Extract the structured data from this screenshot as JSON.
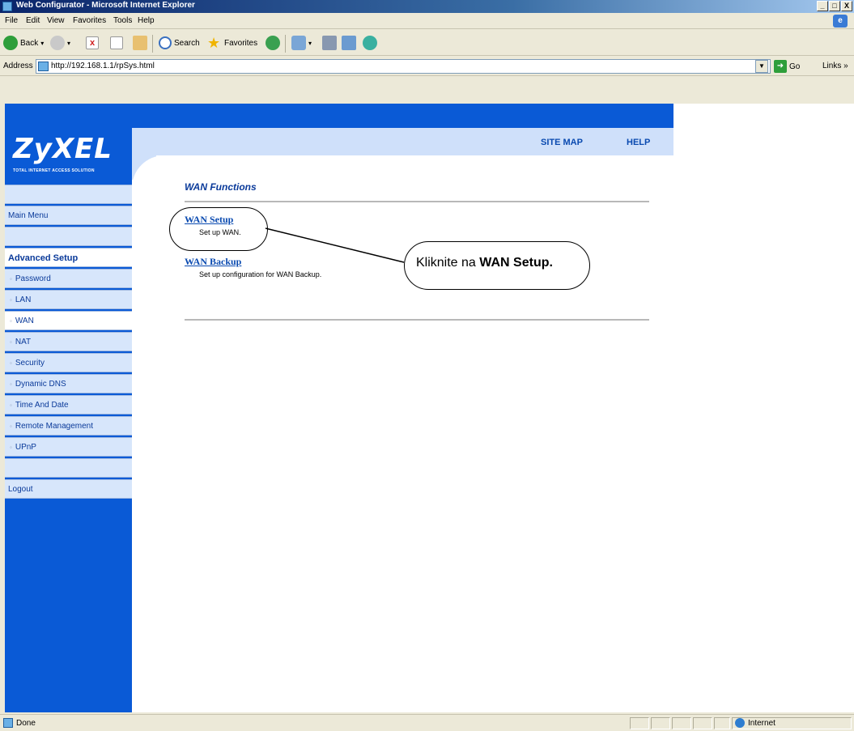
{
  "window": {
    "title": "Web Configurator - Microsoft Internet Explorer",
    "controls": [
      "_",
      "□",
      "X"
    ]
  },
  "menubar": {
    "items": [
      "File",
      "Edit",
      "View",
      "Favorites",
      "Tools",
      "Help"
    ]
  },
  "toolbar": {
    "back_label": "Back",
    "search_label": "Search",
    "favorites_label": "Favorites"
  },
  "address": {
    "label": "Address",
    "url": "http://192.168.1.1/rpSys.html",
    "go_label": "Go",
    "links_label": "Links »"
  },
  "header": {
    "logo": "ZyXEL",
    "logo_tagline": "TOTAL INTERNET ACCESS SOLUTION",
    "site_map": "SITE MAP",
    "help": "HELP"
  },
  "nav": {
    "main_menu": "Main Menu",
    "group": "Advanced Setup",
    "items": [
      "Password",
      "LAN",
      "WAN",
      "NAT",
      "Security",
      "Dynamic DNS",
      "Time And Date",
      "Remote Management",
      "UPnP"
    ],
    "active": "WAN",
    "logout": "Logout"
  },
  "main": {
    "title": "WAN Functions",
    "links": [
      {
        "label": "WAN Setup",
        "desc": "Set up WAN."
      },
      {
        "label": "WAN Backup",
        "desc": "Set up configuration for WAN Backup."
      }
    ]
  },
  "annotation": {
    "text_prefix": "Kliknite na ",
    "text_bold": "WAN Setup."
  },
  "status": {
    "text": "Done",
    "zone": "Internet"
  }
}
